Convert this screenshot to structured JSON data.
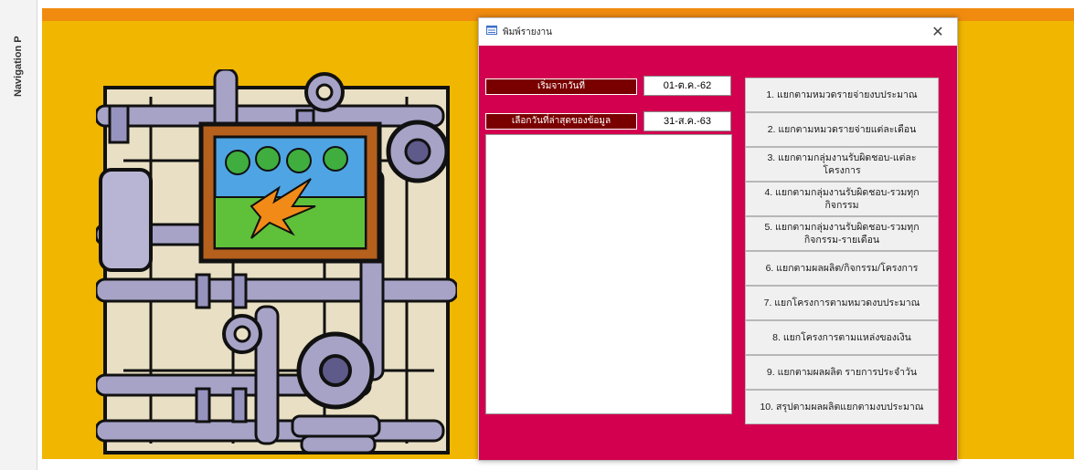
{
  "nav_pane": {
    "label": "Navigation P"
  },
  "colors": {
    "orange_bar": "#f18b10",
    "form_background": "#f1b600",
    "dialog_body": "#d2004f",
    "label_bg": "#7a0000"
  },
  "dialog": {
    "title": "พิมพ์รายงาน",
    "close_glyph": "✕",
    "start_date_label": "เริ่มจากวันที่",
    "start_date_value": "01-ต.ค.-62",
    "end_date_label": "เลือกวันที่ล่าสุดของข้อมูล",
    "end_date_value": "31-ส.ค.-63",
    "report_buttons": [
      "1. แยกตามหมวดรายจ่ายงบประมาณ",
      "2. แยกตามหมวดรายจ่ายแต่ละเดือน",
      "3. แยกตามกลุ่มงานรับผิดชอบ-แต่ละโครงการ",
      "4. แยกตามกลุ่มงานรับผิดชอบ-รวมทุกกิจกรรม",
      "5. แยกตามกลุ่มงานรับผิดชอบ-รวมทุกกิจกรรม-รายเดือน",
      "6. แยกตามผลผลิต/กิจกรรม/โครงการ",
      "7. แยกโครงการตามหมวดงบประมาณ",
      "8. แยกโครงการตามแหล่งของเงิน",
      "9. แยกตามผลผลิต รายการประจำวัน",
      "10. สรุปตามผลผลิตแยกตามงบประมาณ"
    ]
  }
}
